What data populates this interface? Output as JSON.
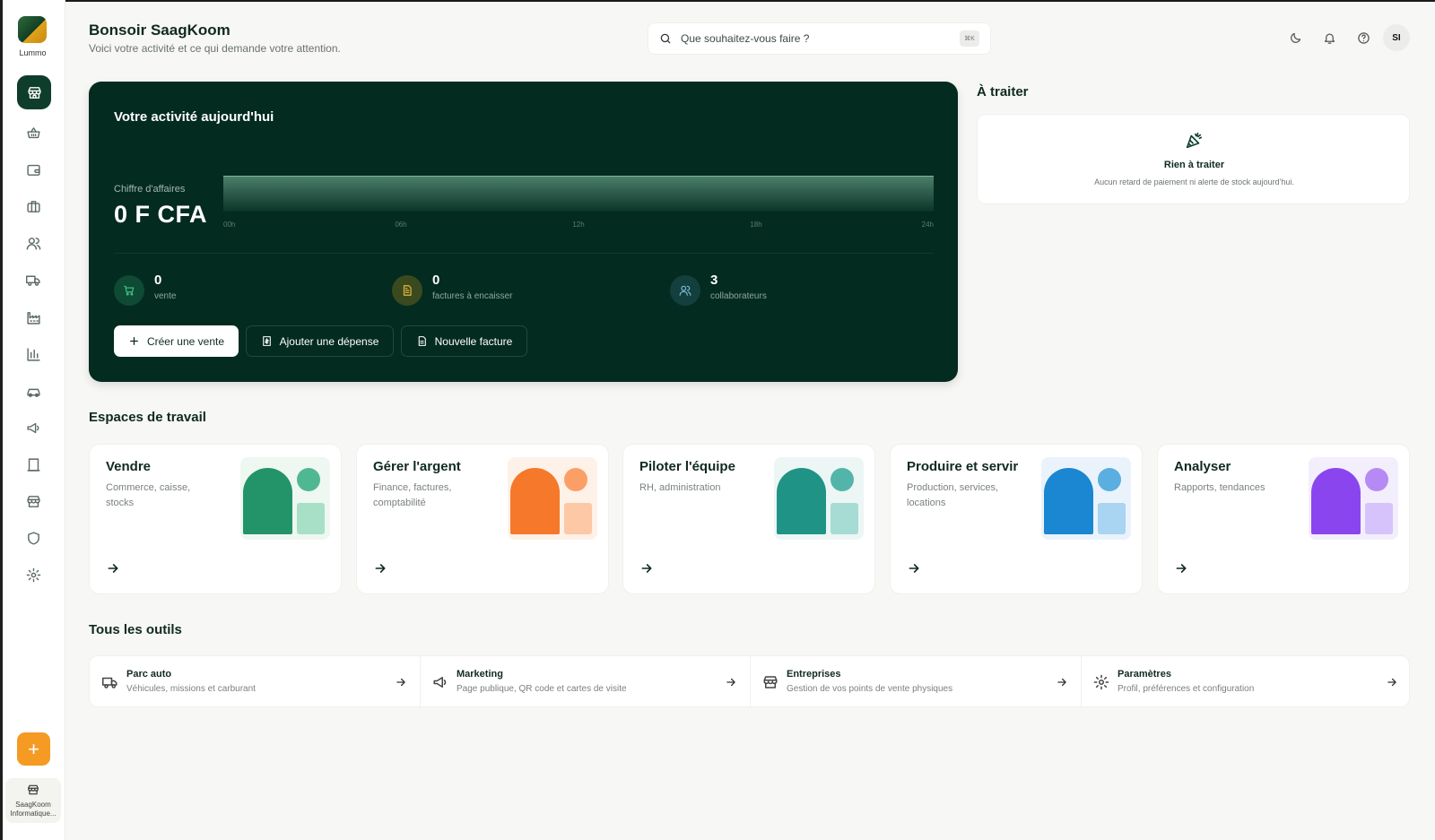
{
  "app": {
    "name": "Lummo",
    "store_label": "SaagKoom Informatique..."
  },
  "header": {
    "greeting": "Bonsoir SaagKoom",
    "subtitle": "Voici votre activité et ce qui demande votre attention.",
    "search_placeholder": "Que souhaitez-vous faire ?",
    "search_shortcut": "⌘K",
    "avatar_initials": "SI"
  },
  "activity": {
    "title": "Votre activité aujourd'hui",
    "revenue_label": "Chiffre d'affaires",
    "revenue_value": "0 F CFA",
    "chart_data": {
      "type": "area",
      "x": [
        "00h",
        "06h",
        "12h",
        "18h",
        "24h"
      ],
      "values": [
        0,
        0,
        0,
        0,
        0
      ]
    },
    "stats": [
      {
        "value": "0",
        "label": "vente",
        "icon": "cart-icon",
        "color": "#1f7a4f"
      },
      {
        "value": "0",
        "label": "factures à encaisser",
        "icon": "invoice-icon",
        "color": "#d6a21f"
      },
      {
        "value": "3",
        "label": "collaborateurs",
        "icon": "users-icon",
        "color": "#4f8fb0"
      }
    ],
    "actions": {
      "create_sale": "Créer une vente",
      "add_expense": "Ajouter une dépense",
      "new_invoice": "Nouvelle facture"
    }
  },
  "todo": {
    "title": "À traiter",
    "empty_title": "Rien à traiter",
    "empty_subtitle": "Aucun retard de paiement ni alerte de stock aujourd'hui."
  },
  "workspaces": {
    "title": "Espaces de travail",
    "items": [
      {
        "title": "Vendre",
        "desc": "Commerce, caisse, stocks",
        "colors": {
          "bg": "#eef7f1",
          "arch": "#23936a",
          "dot": "#4fb892",
          "sq": "#a8e0c7"
        }
      },
      {
        "title": "Gérer l'argent",
        "desc": "Finance, factures, comptabilité",
        "colors": {
          "bg": "#fdf1e8",
          "arch": "#f6782a",
          "dot": "#fb9f66",
          "sq": "#fdc8a5"
        }
      },
      {
        "title": "Piloter l'équipe",
        "desc": "RH, administration",
        "colors": {
          "bg": "#ecf6f5",
          "arch": "#1f9386",
          "dot": "#53b4aa",
          "sq": "#a6dcd4"
        }
      },
      {
        "title": "Produire et servir",
        "desc": "Production, services, locations",
        "colors": {
          "bg": "#eaf3fb",
          "arch": "#1b86d1",
          "dot": "#5aaee0",
          "sq": "#a9d4f2"
        }
      },
      {
        "title": "Analyser",
        "desc": "Rapports, tendances",
        "colors": {
          "bg": "#f3eefc",
          "arch": "#8b45ee",
          "dot": "#b58af5",
          "sq": "#d7c3fb"
        }
      }
    ]
  },
  "tools": {
    "title": "Tous les outils",
    "items": [
      {
        "name": "Parc auto",
        "desc": "Véhicules, missions et carburant",
        "icon": "truck-icon"
      },
      {
        "name": "Marketing",
        "desc": "Page publique, QR code et cartes de visite",
        "icon": "megaphone-icon"
      },
      {
        "name": "Entreprises",
        "desc": "Gestion de vos points de vente physiques",
        "icon": "store-icon"
      },
      {
        "name": "Paramètres",
        "desc": "Profil, préférences et configuration",
        "icon": "gear-icon"
      }
    ]
  }
}
